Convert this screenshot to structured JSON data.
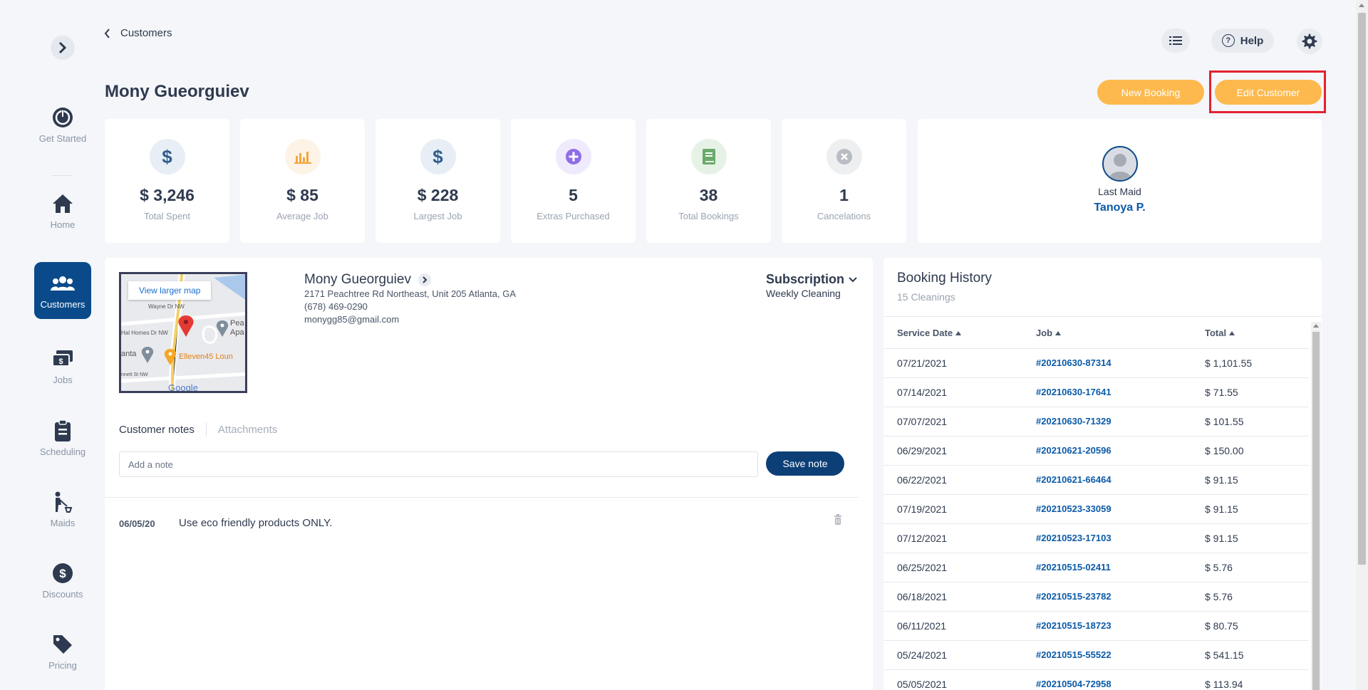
{
  "breadcrumb": {
    "label": "Customers"
  },
  "top": {
    "help_label": "Help"
  },
  "sidebar": {
    "items": [
      {
        "label": "Get Started",
        "icon": "power-icon"
      },
      {
        "label": "Home",
        "icon": "home-icon"
      },
      {
        "label": "Customers",
        "icon": "users-icon",
        "active": true
      },
      {
        "label": "Jobs",
        "icon": "jobs-icon"
      },
      {
        "label": "Scheduling",
        "icon": "clipboard-icon"
      },
      {
        "label": "Maids",
        "icon": "maid-icon"
      },
      {
        "label": "Discounts",
        "icon": "discount-icon"
      },
      {
        "label": "Pricing",
        "icon": "tag-icon"
      }
    ]
  },
  "page": {
    "title": "Mony Gueorguiev"
  },
  "actions": {
    "new_booking": "New Booking",
    "edit_customer": "Edit Customer"
  },
  "stats": [
    {
      "value": "$ 3,246",
      "label": "Total Spent",
      "icon": "dollar-icon",
      "color": "#2f5d8c"
    },
    {
      "value": "$ 85",
      "label": "Average Job",
      "icon": "bar-chart-icon",
      "color": "#f4a640"
    },
    {
      "value": "$ 228",
      "label": "Largest Job",
      "icon": "dollar-icon",
      "color": "#2f5d8c"
    },
    {
      "value": "5",
      "label": "Extras Purchased",
      "icon": "plus-icon",
      "color": "#8e6ee6"
    },
    {
      "value": "38",
      "label": "Total Bookings",
      "icon": "book-icon",
      "color": "#6aaa6a"
    },
    {
      "value": "1",
      "label": "Cancelations",
      "icon": "x-circle-icon",
      "color": "#b8bcc3"
    }
  ],
  "last_maid": {
    "label": "Last Maid",
    "name": "Tanoya P."
  },
  "customer": {
    "name": "Mony Gueorguiev",
    "address": "2171 Peachtree Rd Northeast, Unit 205 Atlanta, GA",
    "phone": "(678) 469-0290",
    "email": "monygg85@gmail.com",
    "subscription_label": "Subscription",
    "subscription_value": "Weekly Cleaning"
  },
  "map": {
    "view_larger": "View larger map",
    "labels": [
      "Wayne Dr NW",
      "Hal Homes Dr NW",
      "anta",
      "Pea",
      "Apa",
      "Elleven45 Loun",
      "nnett St NW"
    ],
    "brand": "Google"
  },
  "notes": {
    "tab_notes": "Customer notes",
    "tab_attachments": "Attachments",
    "placeholder": "Add a note",
    "save_label": "Save note",
    "items": [
      {
        "date": "06/05/20",
        "text": "Use eco friendly products ONLY."
      }
    ]
  },
  "booking_history": {
    "title": "Booking History",
    "subtitle": "15 Cleanings",
    "columns": [
      "Service Date",
      "Job",
      "Total"
    ],
    "rows": [
      [
        "07/21/2021",
        "#20210630-87314",
        "$ 1,101.55"
      ],
      [
        "07/14/2021",
        "#20210630-17641",
        "$ 71.55"
      ],
      [
        "07/07/2021",
        "#20210630-71329",
        "$ 101.55"
      ],
      [
        "06/29/2021",
        "#20210621-20596",
        "$ 150.00"
      ],
      [
        "06/22/2021",
        "#20210621-66464",
        "$ 91.15"
      ],
      [
        "07/19/2021",
        "#20210523-33059",
        "$ 91.15"
      ],
      [
        "07/12/2021",
        "#20210523-17103",
        "$ 91.15"
      ],
      [
        "06/25/2021",
        "#20210515-02411",
        "$ 5.76"
      ],
      [
        "06/18/2021",
        "#20210515-23782",
        "$ 5.76"
      ],
      [
        "06/11/2021",
        "#20210515-18723",
        "$ 80.75"
      ],
      [
        "05/24/2021",
        "#20210515-55522",
        "$ 541.15"
      ],
      [
        "05/05/2021",
        "#20210504-72958",
        "$ 113.94"
      ]
    ]
  },
  "colors": {
    "accent": "#fdb94d",
    "primary": "#0a4a8a",
    "annotation": "#e5202e"
  }
}
